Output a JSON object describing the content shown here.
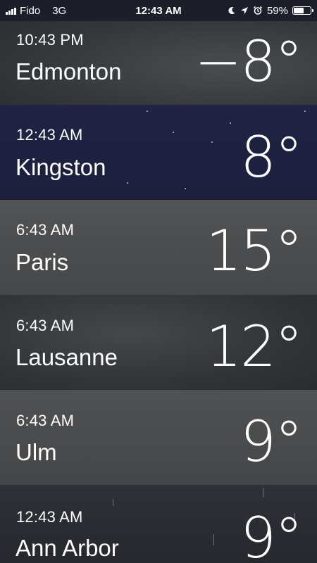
{
  "status_bar": {
    "carrier": "Fido",
    "network": "3G",
    "time": "12:43 AM",
    "battery_percent": "59%",
    "battery_level": 0.59
  },
  "cities": [
    {
      "time": "10:43 PM",
      "name": "Edmonton",
      "temp": "−8°",
      "background": "cloudy-dark"
    },
    {
      "time": "12:43 AM",
      "name": "Kingston",
      "temp": "8°",
      "background": "clear-night"
    },
    {
      "time": "6:43 AM",
      "name": "Paris",
      "temp": "15°",
      "background": "cloudy"
    },
    {
      "time": "6:43 AM",
      "name": "Lausanne",
      "temp": "12°",
      "background": "cloudy-dark"
    },
    {
      "time": "6:43 AM",
      "name": "Ulm",
      "temp": "9°",
      "background": "cloudy"
    },
    {
      "time": "12:43 AM",
      "name": "Ann Arbor",
      "temp": "9°",
      "background": "rain-night"
    }
  ],
  "colors": {
    "status_bar": "#1c1f29",
    "cloudy_dark": "#3a3d40",
    "clear_night": "#1d2040",
    "cloudy": "#4a4c4e",
    "rain_night": "#2a2c33"
  }
}
